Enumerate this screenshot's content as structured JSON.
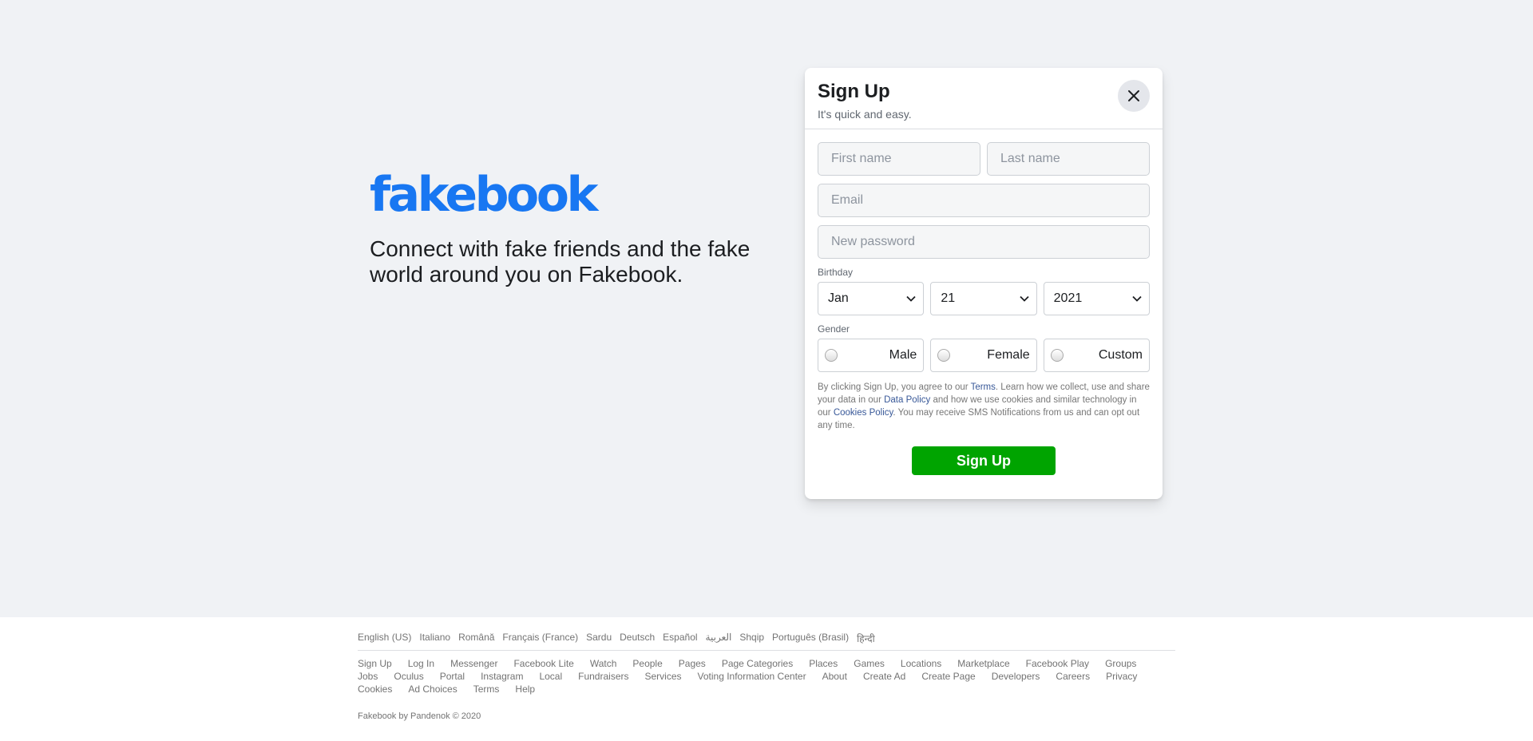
{
  "hero": {
    "logo": "fakebook",
    "tagline": "Connect with fake friends and the fake world around you on Fakebook."
  },
  "modal": {
    "title": "Sign Up",
    "subtitle": "It's quick and easy.",
    "close_icon": "close-icon",
    "first_name_placeholder": "First name",
    "last_name_placeholder": "Last name",
    "email_placeholder": "Email",
    "password_placeholder": "New password",
    "birthday_label": "Birthday",
    "birthday": {
      "month": "Jan",
      "day": "21",
      "year": "2021"
    },
    "gender_label": "Gender",
    "genders": [
      "Male",
      "Female",
      "Custom"
    ],
    "legal": {
      "p1": "By clicking Sign Up, you agree to our ",
      "terms": "Terms",
      "p2": ". Learn how we collect, use and share your data in our ",
      "data_policy": "Data Policy",
      "p3": " and how we use cookies and similar technology in our ",
      "cookies_policy": "Cookies Policy",
      "p4": ". You may receive SMS Notifications from us and can opt out any time."
    },
    "submit_label": "Sign Up",
    "colors": {
      "submit": "#00a400",
      "link": "#385898",
      "brand": "#1877f2"
    }
  },
  "footer": {
    "languages": [
      "English (US)",
      "Italiano",
      "Română",
      "Français (France)",
      "Sardu",
      "Deutsch",
      "Español",
      "العربية",
      "Shqip",
      "Português (Brasil)",
      "हिन्दी"
    ],
    "links": [
      "Sign Up",
      "Log In",
      "Messenger",
      "Facebook Lite",
      "Watch",
      "People",
      "Pages",
      "Page Categories",
      "Places",
      "Games",
      "Locations",
      "Marketplace",
      "Facebook Play",
      "Groups",
      "Jobs",
      "Oculus",
      "Portal",
      "Instagram",
      "Local",
      "Fundraisers",
      "Services",
      "Voting Information Center",
      "About",
      "Create Ad",
      "Create Page",
      "Developers",
      "Careers",
      "Privacy",
      "Cookies",
      "Ad Choices",
      "Terms",
      "Help"
    ],
    "copyright": "Fakebook by Pandenok © 2020"
  }
}
